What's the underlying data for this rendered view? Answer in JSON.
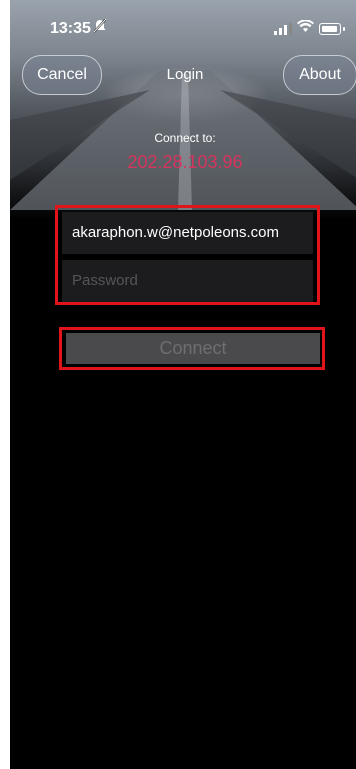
{
  "status": {
    "time": "13:35"
  },
  "nav": {
    "cancel_label": "Cancel",
    "title": "Login",
    "about_label": "About"
  },
  "connection": {
    "connect_to_label": "Connect to:",
    "server_ip": "202.28.103.96"
  },
  "form": {
    "email_value": "akaraphon.w@netpoleons.com",
    "password_placeholder": "Password",
    "connect_label": "Connect"
  },
  "colors": {
    "accent_ip": "#d6335e",
    "highlight_border": "#e0141b",
    "background": "#000000"
  }
}
